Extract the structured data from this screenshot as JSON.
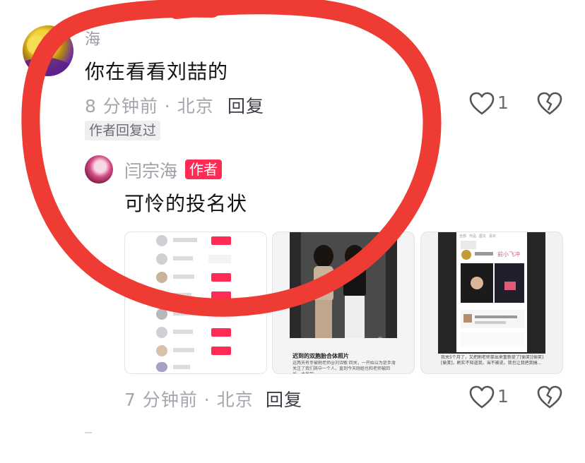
{
  "comment": {
    "username": "海",
    "text": "你在看看刘喆的",
    "meta": "8 分钟前 · 北京",
    "reply_label": "回复",
    "like_count": "1",
    "badge": "作者回复过"
  },
  "reply": {
    "username": "闫宗海",
    "author_badge": "作者",
    "text": "可怜的投名状",
    "meta": "7 分钟前 · 北京",
    "reply_label": "回复",
    "like_count": "1"
  },
  "thumbnails": {
    "second": {
      "title": "迟到的双胞胎合体照片",
      "caption": "这两天有幸被刷老师@刘诗敏 回关，一开始以为是手滑关注了我们其中一个人，直到今天刚姐也和老师被回关，才发现..."
    },
    "third": {
      "tabs": [
        "全部",
        "作品",
        "图文",
        "喜欢"
      ],
      "brand": "前小飞冲",
      "caption": "我关5个月了，又把刷老师拿出来重新提了[偷笑][偷笑][偷笑]，刷实不知道我，当不被说，我也让我把我搞..."
    }
  },
  "colors": {
    "author_badge": "#fe2c55",
    "annotation_stroke": "#ee3b33"
  },
  "icons": [
    "heart-icon",
    "broken-heart-icon"
  ]
}
